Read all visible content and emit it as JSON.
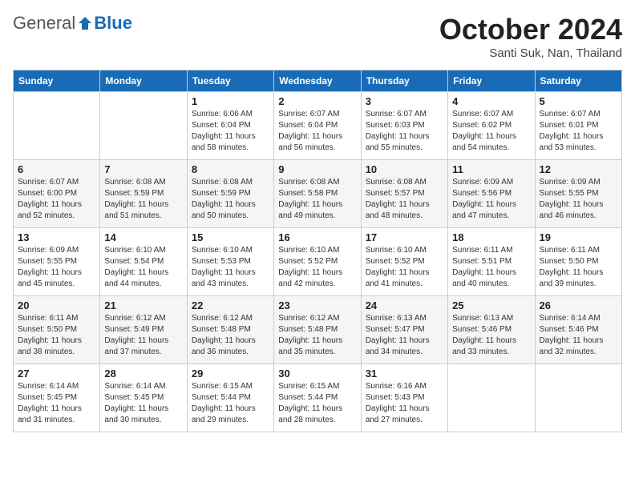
{
  "header": {
    "logo_general": "General",
    "logo_blue": "Blue",
    "month_title": "October 2024",
    "subtitle": "Santi Suk, Nan, Thailand"
  },
  "days_of_week": [
    "Sunday",
    "Monday",
    "Tuesday",
    "Wednesday",
    "Thursday",
    "Friday",
    "Saturday"
  ],
  "weeks": [
    [
      {
        "day": "",
        "sunrise": "",
        "sunset": "",
        "daylight": ""
      },
      {
        "day": "",
        "sunrise": "",
        "sunset": "",
        "daylight": ""
      },
      {
        "day": "1",
        "sunrise": "Sunrise: 6:06 AM",
        "sunset": "Sunset: 6:04 PM",
        "daylight": "Daylight: 11 hours and 58 minutes."
      },
      {
        "day": "2",
        "sunrise": "Sunrise: 6:07 AM",
        "sunset": "Sunset: 6:04 PM",
        "daylight": "Daylight: 11 hours and 56 minutes."
      },
      {
        "day": "3",
        "sunrise": "Sunrise: 6:07 AM",
        "sunset": "Sunset: 6:03 PM",
        "daylight": "Daylight: 11 hours and 55 minutes."
      },
      {
        "day": "4",
        "sunrise": "Sunrise: 6:07 AM",
        "sunset": "Sunset: 6:02 PM",
        "daylight": "Daylight: 11 hours and 54 minutes."
      },
      {
        "day": "5",
        "sunrise": "Sunrise: 6:07 AM",
        "sunset": "Sunset: 6:01 PM",
        "daylight": "Daylight: 11 hours and 53 minutes."
      }
    ],
    [
      {
        "day": "6",
        "sunrise": "Sunrise: 6:07 AM",
        "sunset": "Sunset: 6:00 PM",
        "daylight": "Daylight: 11 hours and 52 minutes."
      },
      {
        "day": "7",
        "sunrise": "Sunrise: 6:08 AM",
        "sunset": "Sunset: 5:59 PM",
        "daylight": "Daylight: 11 hours and 51 minutes."
      },
      {
        "day": "8",
        "sunrise": "Sunrise: 6:08 AM",
        "sunset": "Sunset: 5:59 PM",
        "daylight": "Daylight: 11 hours and 50 minutes."
      },
      {
        "day": "9",
        "sunrise": "Sunrise: 6:08 AM",
        "sunset": "Sunset: 5:58 PM",
        "daylight": "Daylight: 11 hours and 49 minutes."
      },
      {
        "day": "10",
        "sunrise": "Sunrise: 6:08 AM",
        "sunset": "Sunset: 5:57 PM",
        "daylight": "Daylight: 11 hours and 48 minutes."
      },
      {
        "day": "11",
        "sunrise": "Sunrise: 6:09 AM",
        "sunset": "Sunset: 5:56 PM",
        "daylight": "Daylight: 11 hours and 47 minutes."
      },
      {
        "day": "12",
        "sunrise": "Sunrise: 6:09 AM",
        "sunset": "Sunset: 5:55 PM",
        "daylight": "Daylight: 11 hours and 46 minutes."
      }
    ],
    [
      {
        "day": "13",
        "sunrise": "Sunrise: 6:09 AM",
        "sunset": "Sunset: 5:55 PM",
        "daylight": "Daylight: 11 hours and 45 minutes."
      },
      {
        "day": "14",
        "sunrise": "Sunrise: 6:10 AM",
        "sunset": "Sunset: 5:54 PM",
        "daylight": "Daylight: 11 hours and 44 minutes."
      },
      {
        "day": "15",
        "sunrise": "Sunrise: 6:10 AM",
        "sunset": "Sunset: 5:53 PM",
        "daylight": "Daylight: 11 hours and 43 minutes."
      },
      {
        "day": "16",
        "sunrise": "Sunrise: 6:10 AM",
        "sunset": "Sunset: 5:52 PM",
        "daylight": "Daylight: 11 hours and 42 minutes."
      },
      {
        "day": "17",
        "sunrise": "Sunrise: 6:10 AM",
        "sunset": "Sunset: 5:52 PM",
        "daylight": "Daylight: 11 hours and 41 minutes."
      },
      {
        "day": "18",
        "sunrise": "Sunrise: 6:11 AM",
        "sunset": "Sunset: 5:51 PM",
        "daylight": "Daylight: 11 hours and 40 minutes."
      },
      {
        "day": "19",
        "sunrise": "Sunrise: 6:11 AM",
        "sunset": "Sunset: 5:50 PM",
        "daylight": "Daylight: 11 hours and 39 minutes."
      }
    ],
    [
      {
        "day": "20",
        "sunrise": "Sunrise: 6:11 AM",
        "sunset": "Sunset: 5:50 PM",
        "daylight": "Daylight: 11 hours and 38 minutes."
      },
      {
        "day": "21",
        "sunrise": "Sunrise: 6:12 AM",
        "sunset": "Sunset: 5:49 PM",
        "daylight": "Daylight: 11 hours and 37 minutes."
      },
      {
        "day": "22",
        "sunrise": "Sunrise: 6:12 AM",
        "sunset": "Sunset: 5:48 PM",
        "daylight": "Daylight: 11 hours and 36 minutes."
      },
      {
        "day": "23",
        "sunrise": "Sunrise: 6:12 AM",
        "sunset": "Sunset: 5:48 PM",
        "daylight": "Daylight: 11 hours and 35 minutes."
      },
      {
        "day": "24",
        "sunrise": "Sunrise: 6:13 AM",
        "sunset": "Sunset: 5:47 PM",
        "daylight": "Daylight: 11 hours and 34 minutes."
      },
      {
        "day": "25",
        "sunrise": "Sunrise: 6:13 AM",
        "sunset": "Sunset: 5:46 PM",
        "daylight": "Daylight: 11 hours and 33 minutes."
      },
      {
        "day": "26",
        "sunrise": "Sunrise: 6:14 AM",
        "sunset": "Sunset: 5:46 PM",
        "daylight": "Daylight: 11 hours and 32 minutes."
      }
    ],
    [
      {
        "day": "27",
        "sunrise": "Sunrise: 6:14 AM",
        "sunset": "Sunset: 5:45 PM",
        "daylight": "Daylight: 11 hours and 31 minutes."
      },
      {
        "day": "28",
        "sunrise": "Sunrise: 6:14 AM",
        "sunset": "Sunset: 5:45 PM",
        "daylight": "Daylight: 11 hours and 30 minutes."
      },
      {
        "day": "29",
        "sunrise": "Sunrise: 6:15 AM",
        "sunset": "Sunset: 5:44 PM",
        "daylight": "Daylight: 11 hours and 29 minutes."
      },
      {
        "day": "30",
        "sunrise": "Sunrise: 6:15 AM",
        "sunset": "Sunset: 5:44 PM",
        "daylight": "Daylight: 11 hours and 28 minutes."
      },
      {
        "day": "31",
        "sunrise": "Sunrise: 6:16 AM",
        "sunset": "Sunset: 5:43 PM",
        "daylight": "Daylight: 11 hours and 27 minutes."
      },
      {
        "day": "",
        "sunrise": "",
        "sunset": "",
        "daylight": ""
      },
      {
        "day": "",
        "sunrise": "",
        "sunset": "",
        "daylight": ""
      }
    ]
  ]
}
